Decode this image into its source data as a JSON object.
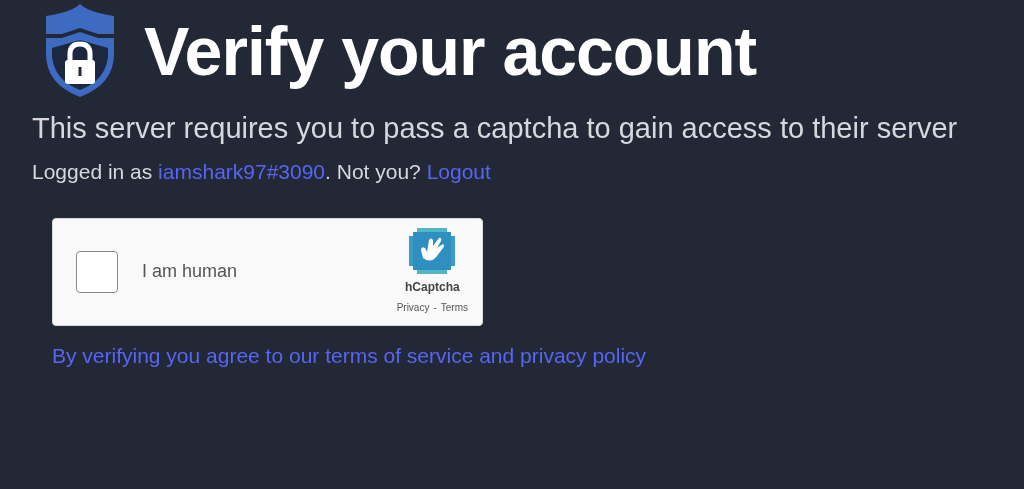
{
  "header": {
    "title": "Verify your account"
  },
  "description": "This server requires you to pass a captcha to gain access to their server",
  "login": {
    "prefix": "Logged in as ",
    "username": "iamshark97#3090",
    "middle": ". Not you? ",
    "logout": "Logout"
  },
  "captcha": {
    "label": "I am human",
    "checked": false,
    "brand": "hCaptcha",
    "privacy": "Privacy",
    "separator": "-",
    "terms": "Terms"
  },
  "footer_link": "By verifying you agree to our terms of service and privacy policy"
}
